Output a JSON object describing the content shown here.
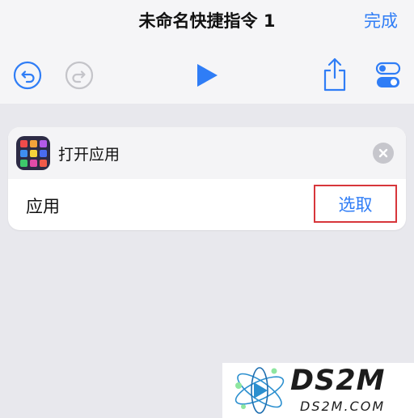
{
  "header": {
    "title": "未命名快捷指令 1",
    "done_label": "完成"
  },
  "toolbar": {
    "icons": [
      "undo-icon",
      "redo-icon",
      "play-icon",
      "share-icon",
      "settings-toggle-icon"
    ],
    "accent_color": "#2f7df6"
  },
  "action_card": {
    "title": "打开应用",
    "row_label": "应用",
    "choose_label": "选取",
    "highlight_color": "#d7363b",
    "app_icon_colors": [
      "#ef4b4b",
      "#f3a33a",
      "#b45ae8",
      "#3f8ef0",
      "#f5d33a",
      "#4a6cf0",
      "#3ec96b",
      "#e14ba8",
      "#f05a4a"
    ]
  },
  "watermark": {
    "brand": "DS2M",
    "site": "DS2M.COM"
  }
}
